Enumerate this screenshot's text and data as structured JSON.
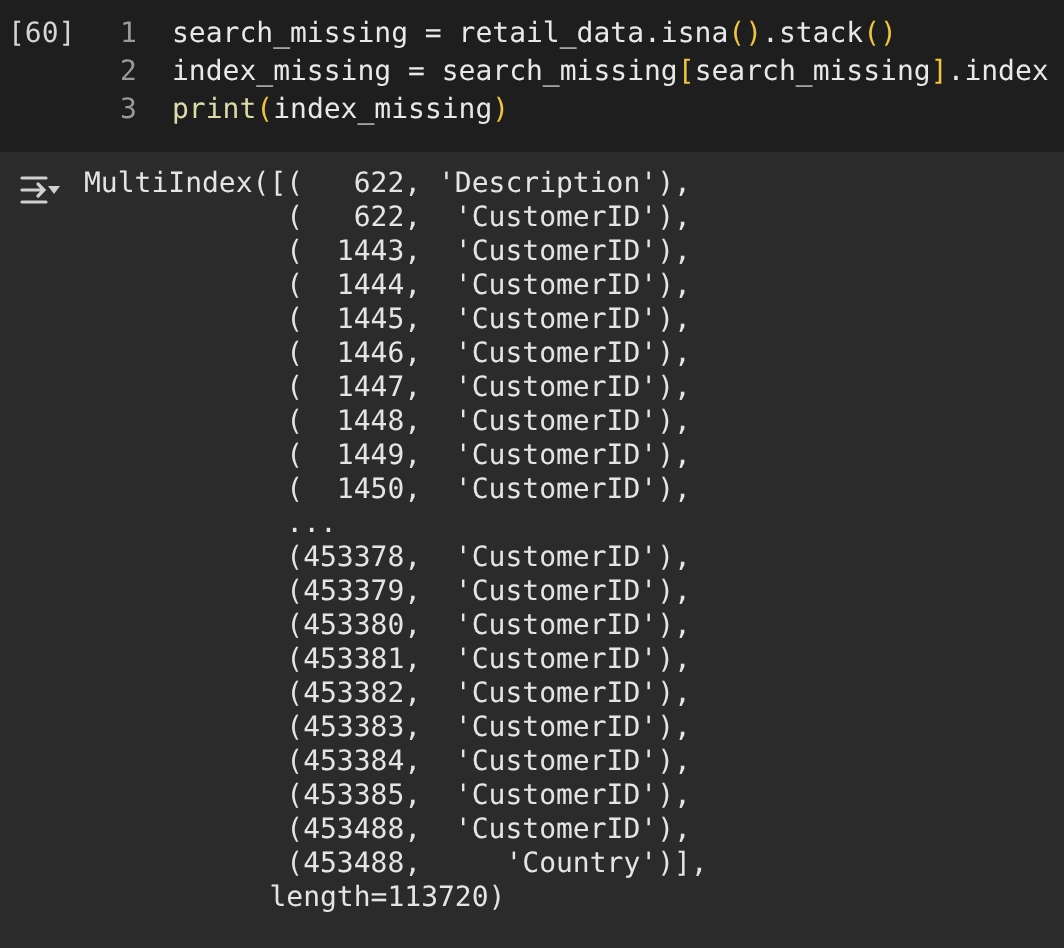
{
  "cell": {
    "execution_count": "[60]",
    "code_lines": [
      {
        "number": "1",
        "tokens": [
          {
            "kind": "plain",
            "text": "search_missing = retail_data.isna"
          },
          {
            "kind": "bracket",
            "text": "()"
          },
          {
            "kind": "plain",
            "text": ".stack"
          },
          {
            "kind": "bracket",
            "text": "()"
          }
        ]
      },
      {
        "number": "2",
        "tokens": [
          {
            "kind": "plain",
            "text": "index_missing = search_missing"
          },
          {
            "kind": "bracket",
            "text": "["
          },
          {
            "kind": "plain",
            "text": "search_missing"
          },
          {
            "kind": "bracket",
            "text": "]"
          },
          {
            "kind": "plain",
            "text": ".index"
          }
        ]
      },
      {
        "number": "3",
        "tokens": [
          {
            "kind": "builtin",
            "text": "print"
          },
          {
            "kind": "bracket",
            "text": "("
          },
          {
            "kind": "plain",
            "text": "index_missing"
          },
          {
            "kind": "bracket",
            "text": ")"
          }
        ]
      }
    ]
  },
  "output": {
    "lines": [
      "MultiIndex([(   622, 'Description'),",
      "            (   622,  'CustomerID'),",
      "            (  1443,  'CustomerID'),",
      "            (  1444,  'CustomerID'),",
      "            (  1445,  'CustomerID'),",
      "            (  1446,  'CustomerID'),",
      "            (  1447,  'CustomerID'),",
      "            (  1448,  'CustomerID'),",
      "            (  1449,  'CustomerID'),",
      "            (  1450,  'CustomerID'),",
      "            ...",
      "            (453378,  'CustomerID'),",
      "            (453379,  'CustomerID'),",
      "            (453380,  'CustomerID'),",
      "            (453381,  'CustomerID'),",
      "            (453382,  'CustomerID'),",
      "            (453383,  'CustomerID'),",
      "            (453384,  'CustomerID'),",
      "            (453385,  'CustomerID'),",
      "            (453488,  'CustomerID'),",
      "            (453488,     'Country')],",
      "           length=113720)"
    ]
  }
}
